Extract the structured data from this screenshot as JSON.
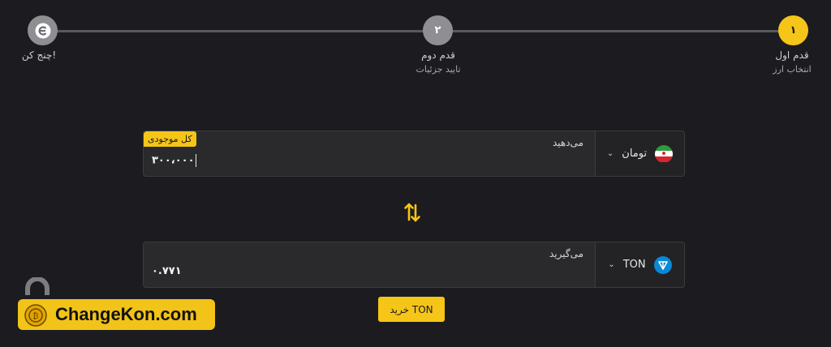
{
  "stepper": {
    "steps": [
      {
        "number": "۱",
        "title": "قدم اول",
        "subtitle": "انتخاب ارز",
        "state": "active"
      },
      {
        "number": "۲",
        "title": "قدم دوم",
        "subtitle": "تایید جزئیات",
        "state": "pending"
      },
      {
        "icon": "changekon-logo-icon",
        "title": "چنج کن!",
        "state": "pending"
      }
    ]
  },
  "give": {
    "label": "می‌دهید",
    "value": "۳۰۰،۰۰۰",
    "badge": "کل موجودی",
    "currency": "تومان",
    "currency_icon": "iran-flag-icon"
  },
  "receive": {
    "label": "می‌گیرید",
    "value": "۰.۷۷۱",
    "currency": "TON",
    "currency_icon": "ton-icon"
  },
  "buy_button": "خرید TON",
  "watermark": {
    "text": "ChangeKon.com"
  },
  "colors": {
    "accent": "#f5c518",
    "background": "#1c1b1f",
    "field": "#2a2a2d",
    "ton": "#0a88d6"
  }
}
